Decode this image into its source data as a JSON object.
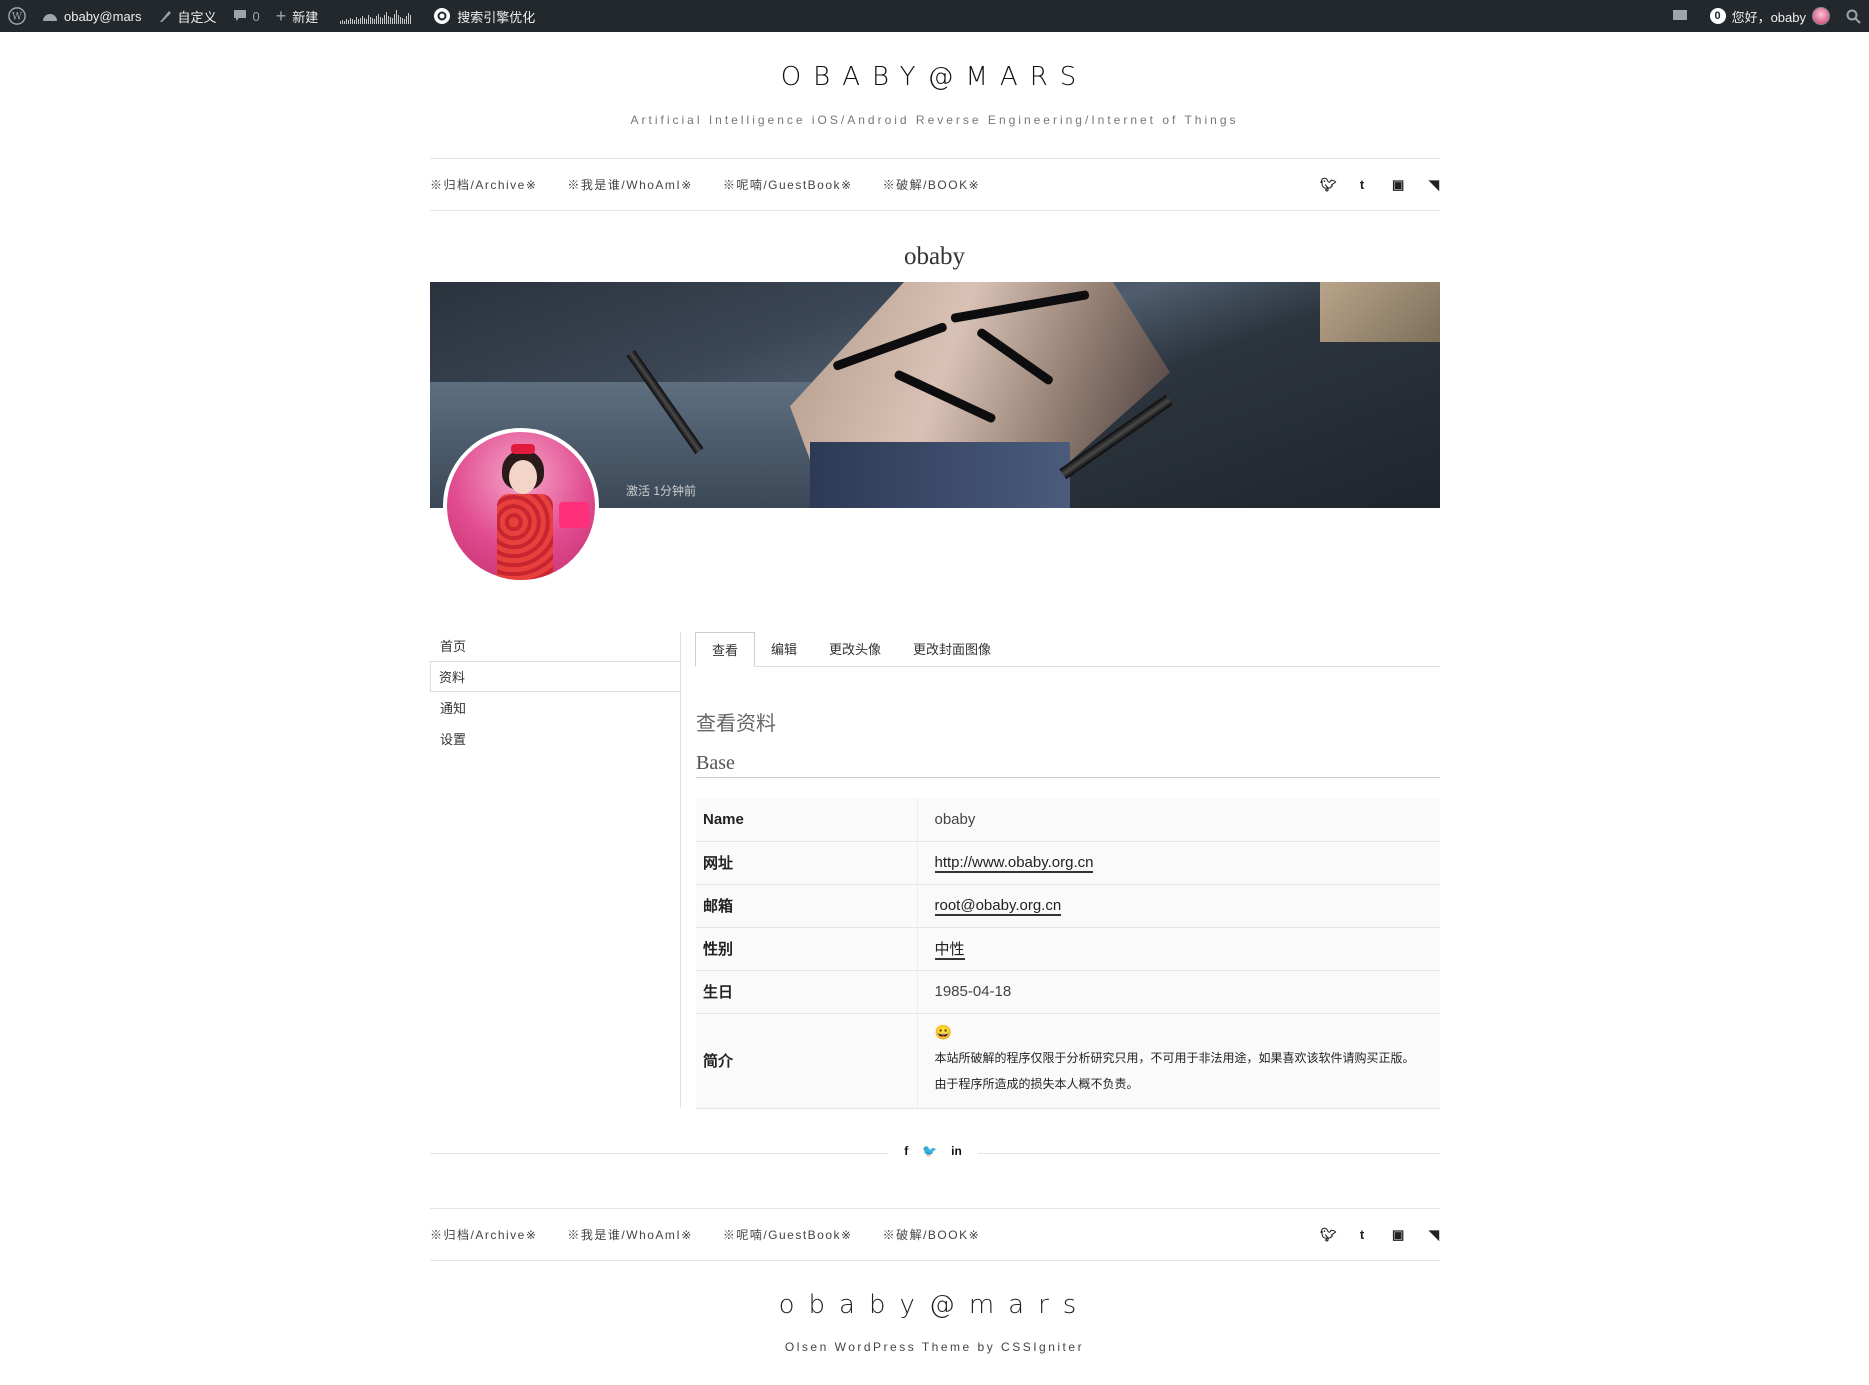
{
  "admin_bar": {
    "site": "obaby@mars",
    "customize": "自定义",
    "comments_count": "0",
    "new": "新建",
    "seo": "搜索引擎优化",
    "notifications": "0",
    "greeting": "您好，obaby"
  },
  "site": {
    "title": "OBABY@MARS",
    "tagline": "Artificial Intelligence iOS/Android Reverse Engineering/Internet of Things"
  },
  "nav": {
    "items": [
      "※归档/Archive※",
      "※我是谁/WhoAmI※",
      "※呢喃/GuestBook※",
      "※破解/BOOK※"
    ],
    "social_icons": [
      "twitter-icon",
      "tumblr-icon",
      "youtube-icon",
      "rss-icon"
    ]
  },
  "profile": {
    "name": "obaby",
    "status": "激活 1分钟前"
  },
  "side_menu": [
    "首页",
    "资料",
    "通知",
    "设置"
  ],
  "tabs": [
    "查看",
    "编辑",
    "更改头像",
    "更改封面图像"
  ],
  "view": {
    "title": "查看资料",
    "group": "Base",
    "fields": [
      {
        "label": "Name",
        "value": "obaby"
      },
      {
        "label": "网址",
        "value": "http://www.obaby.org.cn"
      },
      {
        "label": "邮箱",
        "value": "root@obaby.org.cn"
      },
      {
        "label": "性别",
        "value": "中性"
      },
      {
        "label": "生日",
        "value": "1985-04-18"
      },
      {
        "label": "简介",
        "emoji": "😀",
        "value": "本站所破解的程序仅限于分析研究只用，不可用于非法用途，如果喜欢该软件请购买正版。由于程序所造成的损失本人概不负责。"
      }
    ]
  },
  "share": {
    "icons": [
      "facebook-icon",
      "twitter-icon",
      "linkedin-icon"
    ],
    "glyphs": [
      "f",
      "🐦",
      "in"
    ]
  },
  "footer": {
    "title": "obaby@mars",
    "credit": "Olsen WordPress Theme by CSSIgniter"
  }
}
